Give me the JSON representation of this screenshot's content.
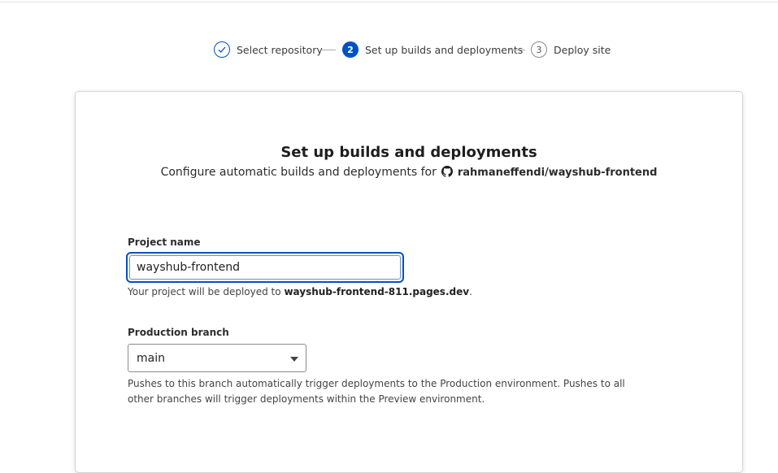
{
  "stepper": {
    "steps": [
      {
        "number": "",
        "label": "Select repository",
        "state": "completed"
      },
      {
        "number": "2",
        "label": "Set up builds and deployments",
        "state": "current"
      },
      {
        "number": "3",
        "label": "Deploy site",
        "state": "upcoming"
      }
    ]
  },
  "card": {
    "title": "Set up builds and deployments",
    "subtitle_prefix": "Configure automatic builds and deployments for",
    "repo_icon": "github-icon",
    "repo_name": "rahmaneffendi/wayshub-frontend"
  },
  "project": {
    "label": "Project name",
    "value": "wayshub-frontend",
    "helper_prefix": "Your project will be deployed to",
    "helper_domain": "wayshub-frontend-811.pages.dev",
    "helper_suffix": "."
  },
  "branch": {
    "label": "Production branch",
    "selected": "main",
    "helper": "Pushes to this branch automatically trigger deployments to the Production environment. Pushes to all other branches will trigger deployments within the Preview environment."
  },
  "colors": {
    "accent": "#0051c3",
    "border": "#d4d4d4"
  }
}
